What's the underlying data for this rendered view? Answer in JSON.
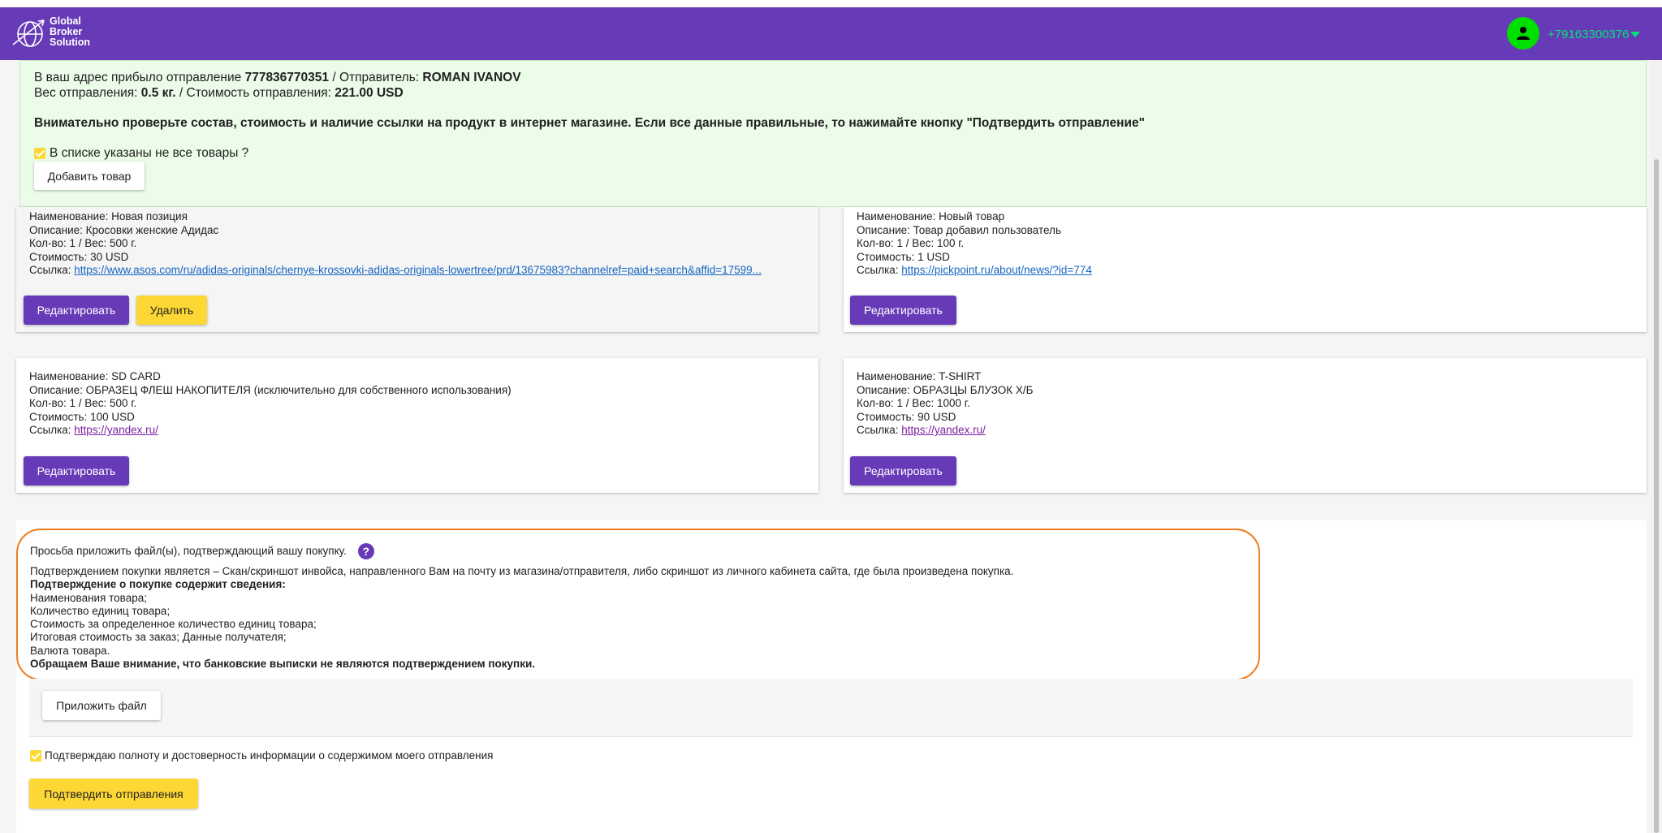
{
  "header": {
    "logo_lines": [
      "Global",
      "Broker",
      "Solution"
    ],
    "phone": "+79163300376"
  },
  "notice": {
    "line1_prefix": "В ваш адрес прибыло отправление ",
    "tracking": "777836770351",
    "line1_mid": " / Отправитель: ",
    "sender": "ROMAN IVANOV",
    "line2_prefix": "Вес отправления: ",
    "weight": "0.5 кг.",
    "line2_mid": " / Стоимость отправления: ",
    "cost": "221.00 USD",
    "warning": "Внимательно проверьте состав, стоимость и наличие ссылки на продукт в интернет магазине. Если все данные правильные, то нажимайте кнопку \"Подтвердить отправление\"",
    "checkbox_label": "В списке указаны не все товары ?",
    "add_button": "Добавить товар"
  },
  "items": [
    {
      "name": "Наименование: Новая позиция",
      "description": "Описание: Кросовки женские Адидас",
      "qty": "Кол-во: 1 / Вес: 500 г.",
      "price": "Стоимость: 30 USD",
      "link_label": "Ссылка: ",
      "link": "https://www.asos.com/ru/adidas-originals/chernye-krossovki-adidas-originals-lowertree/prd/13675983?channelref=paid+search&affid=17599...",
      "edit": "Редактировать",
      "delete": "Удалить"
    },
    {
      "name": "Наименование: Новый товар",
      "description": "Описание: Товар добавил пользователь",
      "qty": "Кол-во: 1 / Вес: 100 г.",
      "price": "Стоимость: 1 USD",
      "link_label": "Ссылка: ",
      "link": "https://pickpoint.ru/about/news/?id=774",
      "edit": "Редактировать"
    },
    {
      "name": "Наименование: SD CARD",
      "description": "Описание: ОБРАЗЕЦ ФЛЕШ НАКОПИТЕЛЯ (исключительно для собственного использования)",
      "qty": "Кол-во: 1 / Вес: 500 г.",
      "price": "Стоимость: 100 USD",
      "link_label": "Ссылка: ",
      "link": "https://yandex.ru/",
      "edit": "Редактировать"
    },
    {
      "name": "Наименование: T-SHIRT",
      "description": "Описание: ОБРАЗЦЫ БЛУЗОК Х/Б",
      "qty": "Кол-во: 1 / Вес: 1000 г.",
      "price": "Стоимость: 90 USD",
      "link_label": "Ссылка: ",
      "link": "https://yandex.ru/",
      "edit": "Редактировать"
    }
  ],
  "attach": {
    "heading": "Просьба приложить файл(ы), подтверждающий вашу покупку.",
    "help": "?",
    "intro": "Подтверждением покупки является – Скан/скриншот инвойса, направленного Вам на почту из магазина/отправителя, либо скриншот из личного кабинета сайта, где была произведена покупка.",
    "contains_title": "Подтверждение о покупке содержит сведения:",
    "line1": "Наименования товара;",
    "line2": "Количество единиц товара;",
    "line3": "Стоимость за определенное количество единиц товара;",
    "line4": "Итоговая стоимость за заказ; Данные получателя;",
    "line5": "Валюта товара.",
    "note": "Обращаем Ваше внимание, что банковские выписки не являются подтверждением покупки.",
    "upload_button": "Приложить файл",
    "confirm_checkbox": "Подтверждаю полноту и достоверность информации о содержимом моего отправления",
    "confirm_button": "Подтвердить отправления"
  },
  "colors": {
    "header": "#673ab7",
    "accent_yellow": "#fdd835",
    "notice_bg": "#ebfce8",
    "hint_border": "#ef7d1f",
    "phone": "#00e676"
  }
}
